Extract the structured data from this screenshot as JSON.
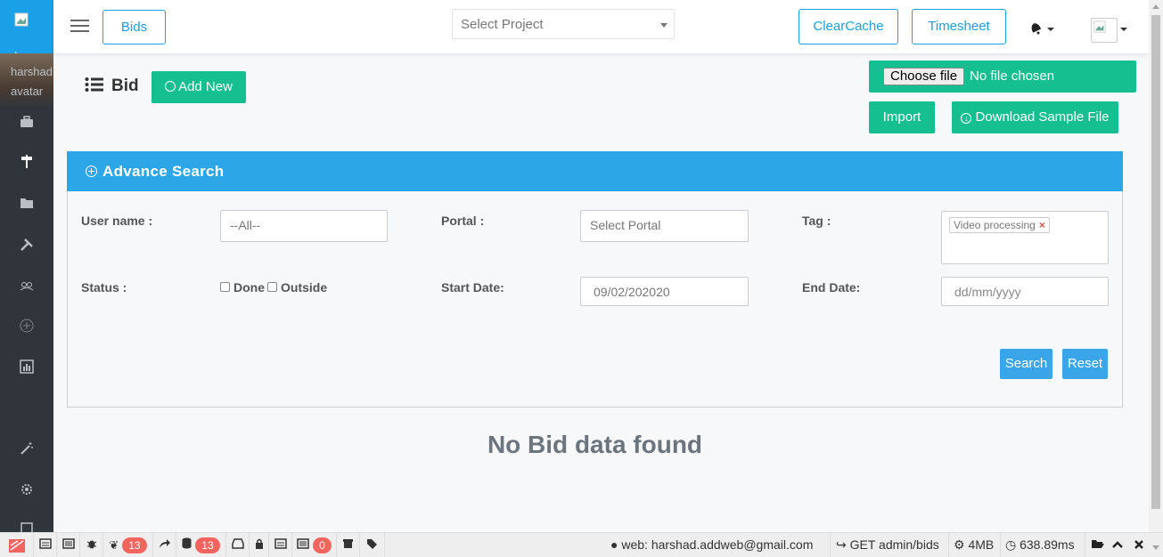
{
  "sidebar": {
    "logo_alt": "Logo",
    "avatar_alt": "harshad avatar",
    "icons": [
      "briefcase-icon",
      "signpost-icon",
      "folder-icon",
      "tools-icon",
      "users-icon",
      "plus-circle-icon",
      "bar-chart-icon",
      "magic-wand-icon",
      "settings-icon"
    ]
  },
  "header": {
    "bids_label": "Bids",
    "project_placeholder": "Select Project",
    "clearcache_label": "ClearCache",
    "timesheet_label": "Timesheet"
  },
  "page": {
    "title": "Bid",
    "add_new_label": "Add New",
    "choose_file_label": "Choose file",
    "no_file_text": "No file chosen",
    "import_label": "Import",
    "download_label": "Download Sample File"
  },
  "search": {
    "title": "Advance Search",
    "username_label": "User name :",
    "username_value": "--All--",
    "portal_label": "Portal :",
    "portal_placeholder": "Select Portal",
    "tag_label": "Tag :",
    "tag_value": "Video processing",
    "tag_remove": "×",
    "status_label": "Status :",
    "status_done": "Done",
    "status_outside": "Outside",
    "start_date_label": "Start Date:",
    "start_date_value": "09/02/202020",
    "end_date_label": "End Date:",
    "end_date_placeholder": "dd/mm/yyyy",
    "search_label": "Search",
    "reset_label": "Reset"
  },
  "empty_message": "No Bid data found",
  "debugbar": {
    "badge_1": "13",
    "badge_2": "13",
    "badge_3": "0",
    "user_text": "web: harshad.addweb@gmail.com",
    "route_text": "GET admin/bids",
    "memory_text": "4MB",
    "time_text": "638.89ms"
  }
}
